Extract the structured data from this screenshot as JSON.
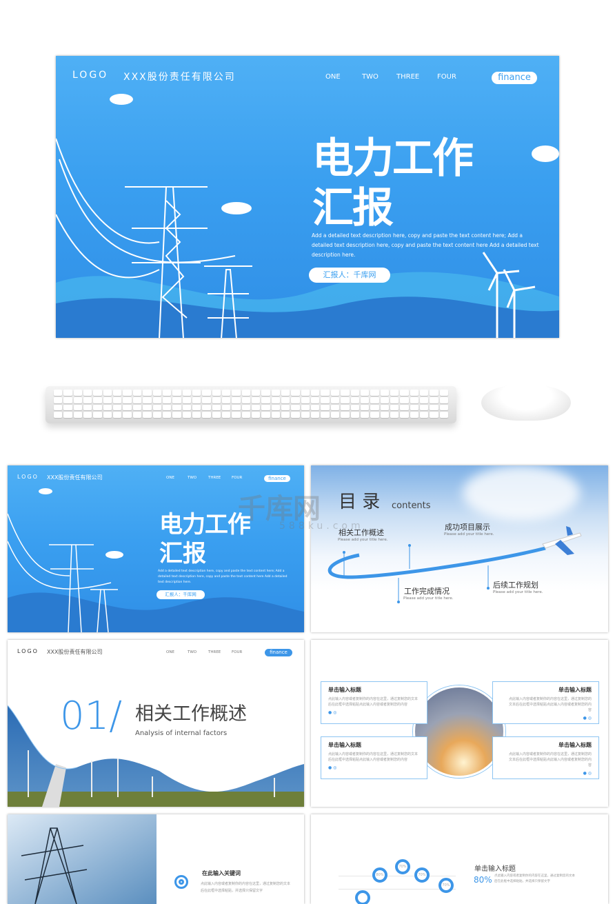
{
  "header": {
    "logo": "LOGO",
    "company": "XXX股份责任有限公司",
    "nav": [
      "ONE",
      "TWO",
      "THREE",
      "FOUR"
    ],
    "badge": "finance"
  },
  "cover": {
    "title_line1": "电力工作",
    "title_line2": "汇报",
    "description": "Add a detailed text description here, copy and paste the text content here; Add a detailed text description here, copy and paste the text content here Add a detailed text description here.",
    "reporter": "汇报人：千库网"
  },
  "toc": {
    "title": "目 录",
    "subtitle": "contents",
    "items": [
      {
        "title": "相关工作概述",
        "sub": "Please add your title here."
      },
      {
        "title": "成功项目展示",
        "sub": "Please add your title here."
      },
      {
        "title": "工作完成情况",
        "sub": "Please add your title here."
      },
      {
        "title": "后续工作规划",
        "sub": "Please add your title here."
      }
    ]
  },
  "section": {
    "number": "01/",
    "title": "相关工作概述",
    "subtitle": "Analysis of internal factors"
  },
  "cards": {
    "items": [
      {
        "title": "单击输入标题",
        "text": "点此输入内容或者复制你的内容在这里，通过复制您的文本后在此框中选择粘贴点此输入内容或者复制您的内容"
      },
      {
        "title": "单击输入标题",
        "text": "点此输入内容或者复制你的内容在这里，通过复制您的文本后在此框中选择粘贴点此输入内容或者复制您的内容"
      },
      {
        "title": "单击输入标题",
        "text": "点此输入内容或者复制你的内容在这里，通过复制您的文本后在此框中选择粘贴点此输入内容或者复制您的内容"
      },
      {
        "title": "单击输入标题",
        "text": "点此输入内容或者复制你的内容在这里，通过复制您的文本后在此框中选择粘贴点此输入内容或者复制您的内容"
      }
    ]
  },
  "keyword": {
    "title": "在此输入关键词",
    "text": "点此输入内容或者复制你的内容在这里，通过复制您的文本后在此框中选择粘贴，并选择只保留文字"
  },
  "stats": {
    "title": "单击输入标题",
    "percent": "80%",
    "text": "点此输入内容或者复制你的内容在这里，通过复制您的文本后在此框中选择粘贴，并选择只保留文字",
    "pins": [
      "80%",
      "70%",
      "70%",
      "70%"
    ]
  },
  "watermark": {
    "brand": "千库网",
    "url": "588ku.com"
  },
  "colors": {
    "accent": "#3d96e8",
    "slide_bg": "#3a9ff0"
  }
}
